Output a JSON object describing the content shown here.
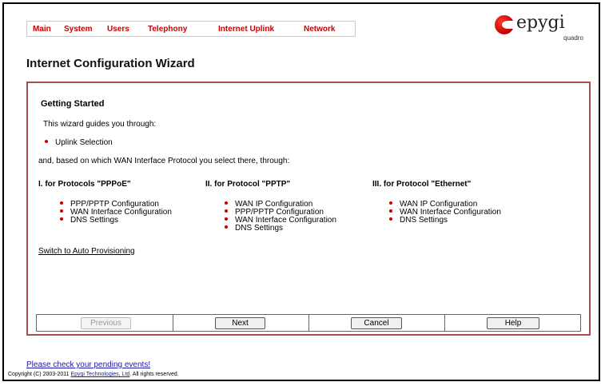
{
  "nav": {
    "items": [
      "Main",
      "System",
      "Users",
      "Telephony",
      "Internet Uplink",
      "Network"
    ]
  },
  "logo": {
    "text": "epygi",
    "subtext": "quadro"
  },
  "page_title": "Internet Configuration Wizard",
  "wizard": {
    "section_title": "Getting Started",
    "intro": "This wizard guides you through:",
    "uplink_item": "Uplink Selection",
    "based_on": "and, based on which WAN Interface Protocol you select there, through:",
    "columns": [
      {
        "title": "I. for Protocols \"PPPoE\"",
        "items": [
          "PPP/PPTP Configuration",
          "WAN Interface Configuration",
          "DNS Settings"
        ]
      },
      {
        "title": "II. for Protocol \"PPTP\"",
        "items": [
          "WAN IP Configuration",
          "PPP/PPTP Configuration",
          "WAN Interface Configuration",
          "DNS Settings"
        ]
      },
      {
        "title": "III. for Protocol \"Ethernet\"",
        "items": [
          "WAN IP Configuration",
          "WAN Interface Configuration",
          "DNS Settings"
        ]
      }
    ],
    "auto_provisioning_link": "Switch to Auto Provisioning",
    "buttons": {
      "previous": "Previous",
      "next": "Next",
      "cancel": "Cancel",
      "help": "Help"
    }
  },
  "footer": {
    "pending_events": "Please check your pending events!",
    "copyright_prefix": "Copyright (C) 2003-2011 ",
    "copyright_company": "Epygi Technologies, Ltd",
    "copyright_suffix": ". All rights reserved."
  },
  "colors": {
    "accent": "#cc0000",
    "panel_border": "#a85050",
    "link": "#1a1aa6"
  }
}
